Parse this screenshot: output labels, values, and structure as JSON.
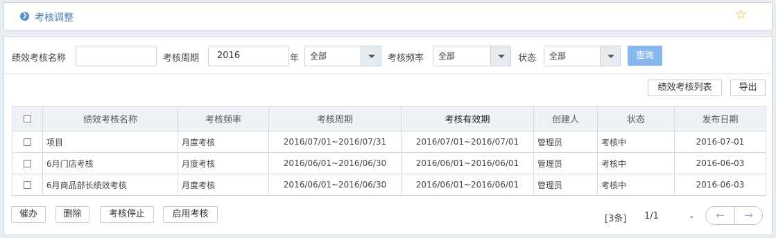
{
  "header": {
    "title": "考核调整",
    "bullet_icon": "chevron-right-circle-icon",
    "star_icon": "star-outline-icon"
  },
  "filters": {
    "name_label": "绩效考核名称",
    "name_value": "",
    "period_label": "考核周期",
    "period_value": "2016",
    "year_suffix": "年",
    "period_select": "全部",
    "freq_label": "考核频率",
    "freq_select": "全部",
    "status_label": "状态",
    "status_select": "全部",
    "query_button": "查询"
  },
  "actions": {
    "list_button": "绩效考核列表",
    "export_button": "导出"
  },
  "table": {
    "columns": [
      "绩效考核名称",
      "考核频率",
      "考核周期",
      "考核有效期",
      "创建人",
      "状态",
      "发布日期"
    ],
    "rows": [
      [
        "项目",
        "月度考核",
        "2016/07/01~2016/07/31",
        "2016/07/01~2016/07/01",
        "管理员",
        "考核中",
        "2016-07-01"
      ],
      [
        "6月门店考核",
        "月度考核",
        "2016/06/01~2016/06/30",
        "2016/06/01~2016/06/01",
        "管理员",
        "考核中",
        "2016-06-03"
      ],
      [
        "6月商品部长绩效考核",
        "月度考核",
        "2016/06/01~2016/06/30",
        "2016/06/01~2016/06/01",
        "管理员",
        "考核中",
        "2016-06-03"
      ]
    ]
  },
  "bottom": {
    "urge": "催办",
    "delete": "删除",
    "stop": "考核停止",
    "enable": "启用考核"
  },
  "pager": {
    "count": "[3条]",
    "page": "1/1",
    "prev_icon": "arrow-left-icon",
    "next_icon": "arrow-right-icon"
  },
  "colors": {
    "accent": "#4a79b8",
    "query": "#87b8ed",
    "star": "#f0a818"
  }
}
